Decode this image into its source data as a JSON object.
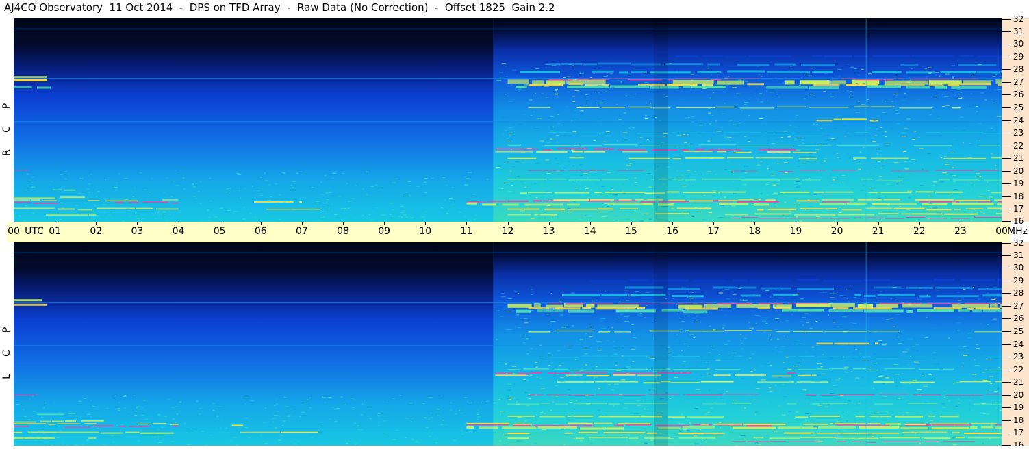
{
  "title": "AJ4CO Observatory  11 Oct 2014  -  DPS on TFD Array  -  Raw Data (No Correction)  -  Offset 1825  Gain 2.2",
  "time_axis": {
    "labels": [
      "00",
      "01",
      "02",
      "03",
      "04",
      "05",
      "06",
      "07",
      "08",
      "09",
      "10",
      "11",
      "12",
      "13",
      "14",
      "15",
      "16",
      "17",
      "18",
      "19",
      "20",
      "21",
      "22",
      "23",
      "00"
    ],
    "utc_label": "UTC",
    "unit_label": "MHz"
  },
  "panels": [
    {
      "id": "rcp",
      "polarization_letters": [
        "R",
        "C",
        "P"
      ]
    },
    {
      "id": "lcp",
      "polarization_letters": [
        "L",
        "C",
        "P"
      ]
    }
  ],
  "chart_data": {
    "type": "heatmap",
    "title": "AJ4CO Observatory  11 Oct 2014  -  DPS on TFD Array  -  Raw Data (No Correction)  -  Offset 1825  Gain 2.2",
    "xlabel": "UTC",
    "ylabel": "MHz",
    "x_range_hours": [
      0,
      24
    ],
    "y_range_mhz": [
      16,
      32
    ],
    "y_ticks": [
      16,
      17,
      18,
      19,
      20,
      21,
      22,
      23,
      24,
      25,
      26,
      27,
      28,
      29,
      30,
      31,
      32
    ],
    "colormap": [
      "#000818",
      "#061a6e",
      "#0b3fd2",
      "#138fe8",
      "#16c4e4",
      "#4fe0b0",
      "#c8f060",
      "#ffe040",
      "#ff3aa0",
      "#ffffff"
    ],
    "series": [
      {
        "name": "RCP"
      },
      {
        "name": "LCP"
      }
    ]
  }
}
